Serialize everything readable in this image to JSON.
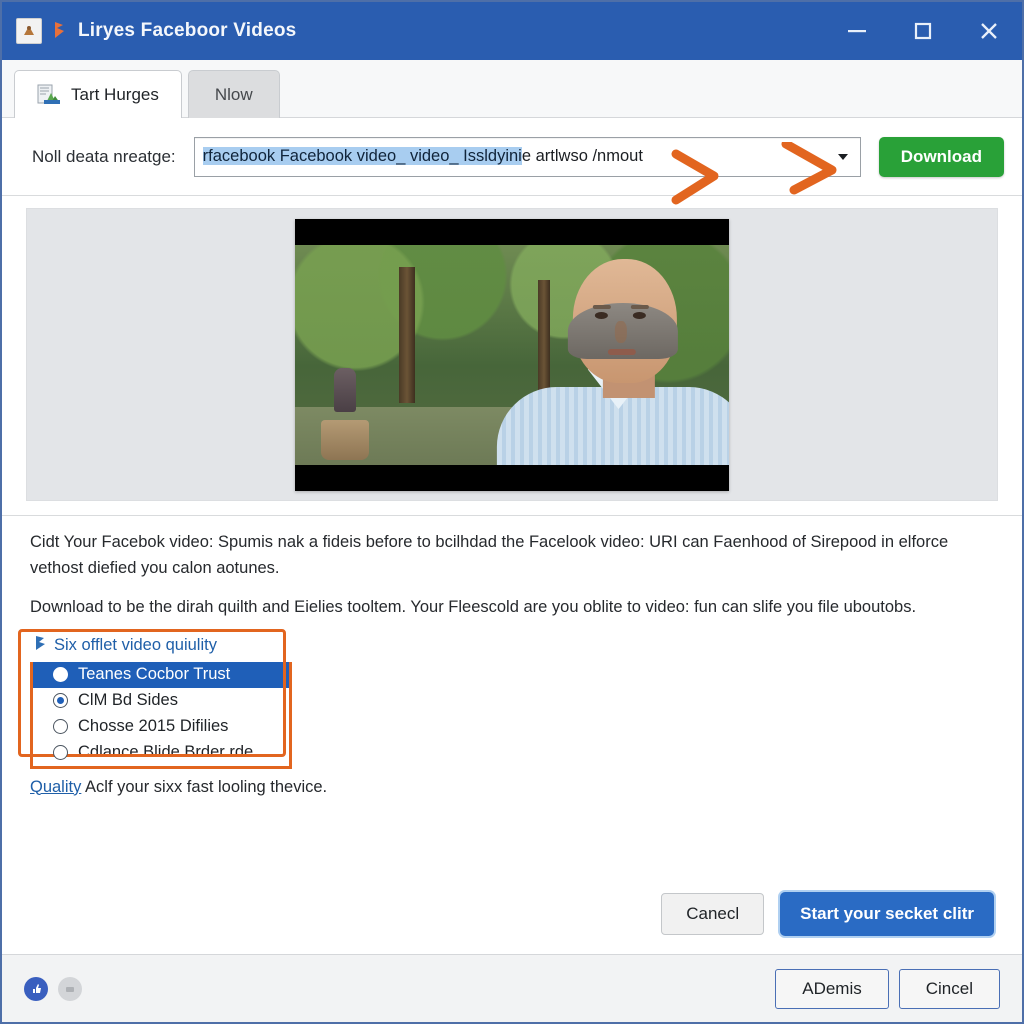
{
  "window": {
    "title": "Liryes Faceboor Videos",
    "app_icon": "app-icon",
    "brand_icon": "facebook-brand-icon",
    "controls": {
      "minimize": "minimize-icon",
      "maximize": "maximize-icon",
      "close": "close-icon"
    }
  },
  "tabs": [
    {
      "label": "Tart Hurges",
      "active": true,
      "icon": "document-image-icon"
    },
    {
      "label": "Nlow",
      "active": false,
      "icon": ""
    }
  ],
  "url_row": {
    "label": "Noll deata nreatge:",
    "value_selected": "rfacebook Facebook video_ video_ Issldyini",
    "value_rest": "e artlwso /nmout",
    "placeholder": "Noll deata nreatge",
    "download_label": "Download",
    "download_color": "#29a138",
    "caret_icon": "chevron-down-icon"
  },
  "annotations": {
    "arrow_color": "#e2651f",
    "arrow_1": "arrow-right",
    "arrow_2": "arrow-right"
  },
  "preview": {
    "name": "video-preview-panel",
    "thumbnail": "video-thumbnail"
  },
  "description": {
    "paragraph_1": "Cidt Your Facebok video: Spumis nak a fideis before to bcilhdad the Facelook video: URI can Faenhood of Sirepood in elforce vethost diefied you calon aotunes.",
    "paragraph_2": "Download to be the dirah quilth and Eielies tooltem. Your Fleescold are you oblite to video: fun can slife you file uboutobs."
  },
  "quality": {
    "header_icon": "lightning-bolt-icon",
    "header_label": "Six offlet video quiulity",
    "box_color": "#e2651f",
    "options": [
      {
        "label": "Teanes Cocbor Trust",
        "state": "highlighted"
      },
      {
        "label": "ClM Bd Sides",
        "state": "checked"
      },
      {
        "label": "Chosse 2015 Difilies",
        "state": "unchecked"
      },
      {
        "label": "Cdlance Blide Brder rde",
        "state": "unchecked"
      }
    ],
    "note_link": "Quality",
    "note_rest": " Aclf your sixx fast looling thevice."
  },
  "actions": {
    "cancel_label": "Canecl",
    "primary_label": "Start your secket clitr"
  },
  "statusbar": {
    "dot_active": "status-active-icon",
    "dot_idle": "status-idle-icon",
    "button_1": "ADemis",
    "button_2": "Cincel"
  }
}
